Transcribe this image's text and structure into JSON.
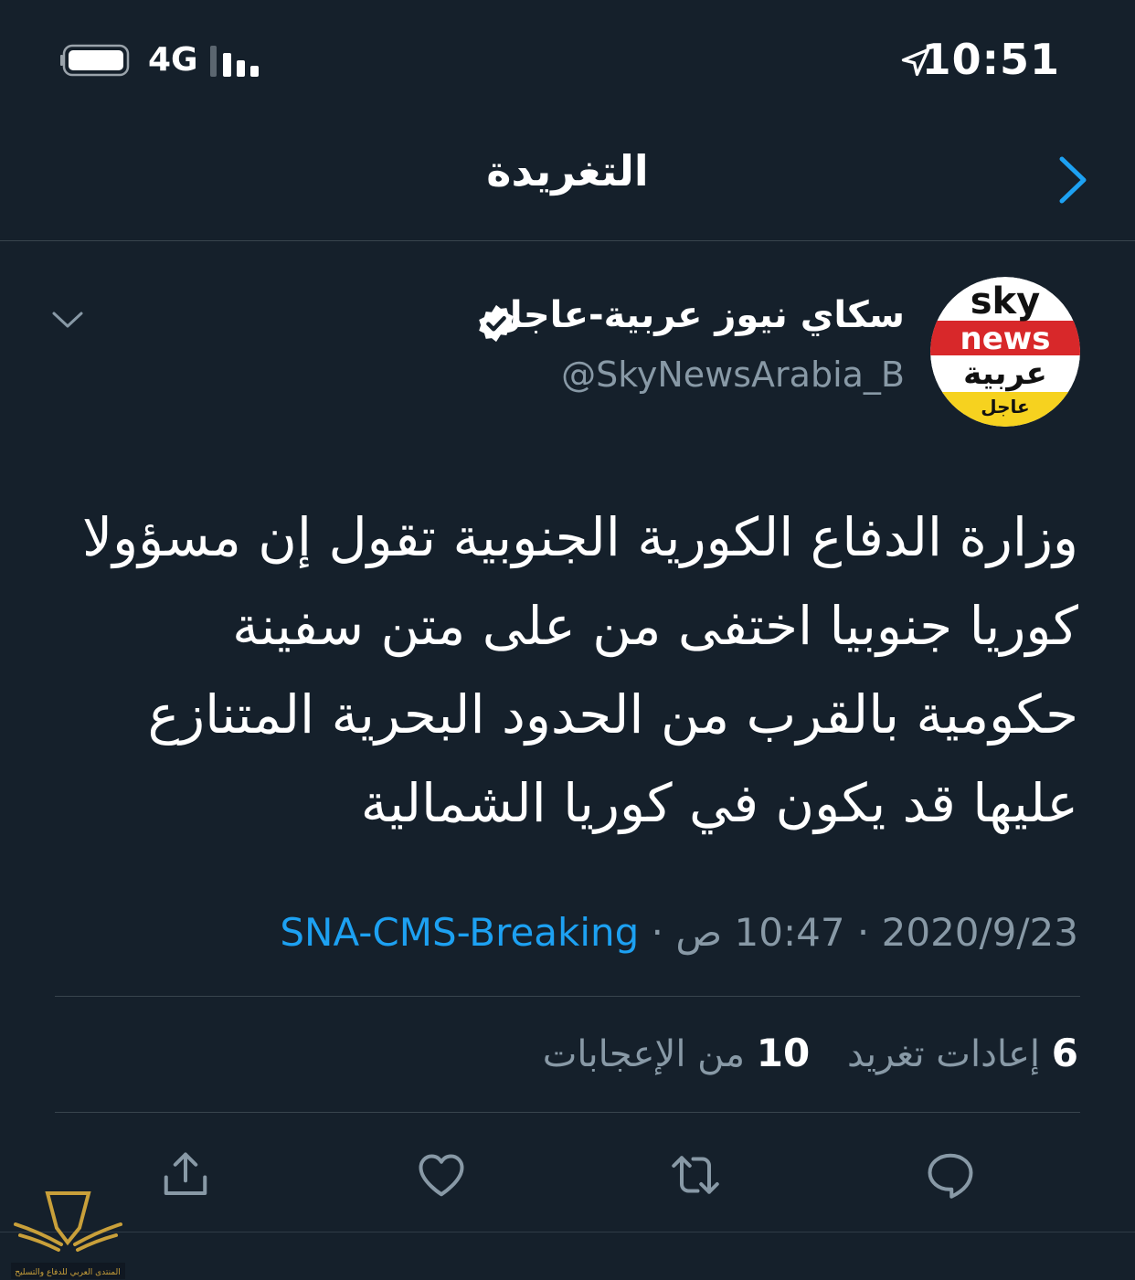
{
  "status_bar": {
    "time": "10:51",
    "network": "4G",
    "icons": [
      "battery-icon",
      "signal-icon",
      "location-arrow-icon"
    ]
  },
  "header": {
    "title": "التغريدة",
    "back_icon": "chevron-right-icon"
  },
  "tweet": {
    "author_name": "سكاي نيوز عربية-عاجل",
    "author_handle": "@SkyNewsArabia_B",
    "avatar": {
      "line1": "sky",
      "line2": "news",
      "line3": "عربية",
      "line4": "عاجل"
    },
    "text": "وزارة الدفاع الكورية الجنوبية تقول إن مسؤولا كوريا جنوبيا اختفى من على متن سفينة حكومية بالقرب من الحدود البحرية المتنازع عليها قد يكون في كوريا الشمالية",
    "date": "2020/9/23",
    "time": "10:47 ص",
    "source": "SNA-CMS-Breaking",
    "separator": "·",
    "retweets_count": "6",
    "retweets_label": "إعادات تغريد",
    "likes_count": "10",
    "likes_label": "من الإعجابات"
  },
  "actions": [
    "reply-icon",
    "retweet-icon",
    "like-icon",
    "share-icon"
  ],
  "colors": {
    "background": "#15202b",
    "accent": "#1da1f2",
    "secondary_text": "#8899a6",
    "divider": "#38444d"
  }
}
